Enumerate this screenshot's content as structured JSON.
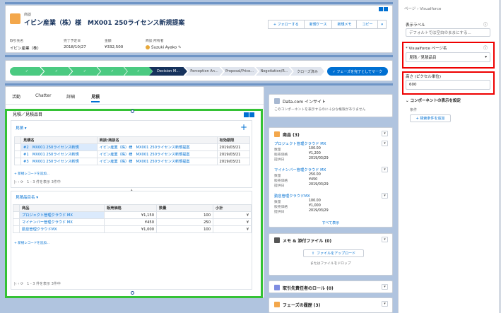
{
  "header": {
    "object_type": "商談",
    "title": "イビン産業（株）様　MX001 250ライセンス新規提案",
    "buttons": [
      "+ フォローする",
      "新規ケース",
      "新規メモ",
      "コピー"
    ],
    "fields": [
      {
        "label": "取引先名",
        "value": "イビン産業（株）"
      },
      {
        "label": "完了予定日",
        "value": "2018/10/27"
      },
      {
        "label": "金額",
        "value": "¥332,500"
      },
      {
        "label": "商談 所有者",
        "value": "Suzuki Ayako"
      }
    ]
  },
  "path": {
    "stages": [
      "",
      "",
      "",
      "",
      "",
      "",
      "Decision M...",
      "Perception An...",
      "Proposal/Price...",
      "Negotiation/R...",
      "クローズ済み"
    ],
    "mark_button": "✓ フェーズを完了としてマーク"
  },
  "tabs": [
    "活動",
    "Chatter",
    "詳細",
    "見積"
  ],
  "vf": {
    "title": "見積／見積品目",
    "list_selector": "見積",
    "quote_table": {
      "headers": [
        "見積名",
        "商談:商談名",
        "有効期限"
      ],
      "rows": [
        [
          "#2　MX001 250ライセンス新規",
          "イビン産業（株）様　MX001 250ライセンス新規提案",
          "2019/03/21"
        ],
        [
          "#1　MX001 250ライセンス新規",
          "イビン産業（株）様　MX001 250ライセンス新規提案",
          "2019/03/21"
        ],
        [
          "#3　MX001 250ライセンス新規",
          "イビン産業（株）様　MX001 250ライセンス新規提案",
          "2019/03/21"
        ]
      ],
      "add_link": "+ 新規レコードを追加...",
      "pager": "1 - 3 件を表示 3件中"
    },
    "item_selector": "見積品目名",
    "item_table": {
      "headers": [
        "商品",
        "販売価格",
        "数量",
        "小計"
      ],
      "rows": [
        [
          "プロジェクト管理クラウド MX",
          "¥1,150",
          "100",
          "¥"
        ],
        [
          "マイナンバー管理クラウド MX",
          "¥450",
          "250",
          "¥"
        ],
        [
          "勤怠管理クラウドMX",
          "¥1,000",
          "100",
          "¥"
        ]
      ],
      "add_link": "+ 新規レコードを追加...",
      "pager": "1 - 3 件を表示 3件中"
    }
  },
  "insight": {
    "title": "Data.com インサイト",
    "text": "このコンポーネントを表示するのに十分な権限がありません"
  },
  "products": {
    "title": "商品 (3)",
    "items": [
      {
        "name": "プロジェクト管理クラウド MX",
        "fields": [
          [
            "数量",
            "100.00"
          ],
          [
            "販売価格",
            "¥1,200"
          ],
          [
            "提供日",
            "2019/03/29"
          ]
        ]
      },
      {
        "name": "マイナンバー管理クラウド MX",
        "fields": [
          [
            "数量",
            "250.00"
          ],
          [
            "販売価格",
            "¥450"
          ],
          [
            "提供日",
            "2019/03/29"
          ]
        ]
      },
      {
        "name": "勤怠管理クラウドMX",
        "fields": [
          [
            "数量",
            "100.00"
          ],
          [
            "販売価格",
            "¥1,000"
          ],
          [
            "提供日",
            "2019/03/29"
          ]
        ]
      }
    ],
    "view_all": "すべて表示"
  },
  "notes": {
    "title": "メモ & 添付ファイル (0)",
    "upload": "ファイルをアップロード",
    "drop": "またはファイルをドロップ"
  },
  "roles": {
    "title": "取引先責任者のロール (0)"
  },
  "history": {
    "title": "フェーズの履歴 (3)"
  },
  "props": {
    "breadcrumb": "ページ › Visualforce",
    "label_title": "表示ラベル",
    "label_placeholder": "デフォルトでは空白のままにする...",
    "page_name_title": "* Visualforce ページ名",
    "page_name_value": "見積／見積品目",
    "height_title": "高さ (ピクセル単位)",
    "height_value": "600",
    "visibility_title": "コンポーネントの表示を設定",
    "filter_title": "条件",
    "filter_button": "+ 検索条件を追加"
  },
  "colors": {
    "accent": "#0070d2",
    "complete": "#4bca81",
    "current": "#16325c",
    "highlight_green": "#35c235",
    "highlight_red": "#e00000"
  }
}
